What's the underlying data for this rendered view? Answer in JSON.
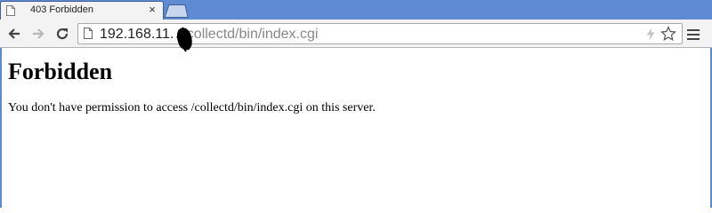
{
  "tab": {
    "title": "403 Forbidden",
    "close_glyph": "×"
  },
  "address_bar": {
    "url_host": "192.168.11.",
    "url_path": "/collectd/bin/index.cgi"
  },
  "icons": {
    "back": "back-arrow-icon",
    "forward": "forward-arrow-icon",
    "reload": "reload-icon",
    "page": "page-icon",
    "bolt": "bolt-icon",
    "star": "star-icon",
    "menu": "hamburger-menu-icon"
  },
  "page": {
    "heading": "Forbidden",
    "message": "You don't have permission to access /collectd/bin/index.cgi on this server."
  },
  "colors": {
    "frame": "#5f8bd3",
    "toolbar": "#f3f3f3"
  }
}
